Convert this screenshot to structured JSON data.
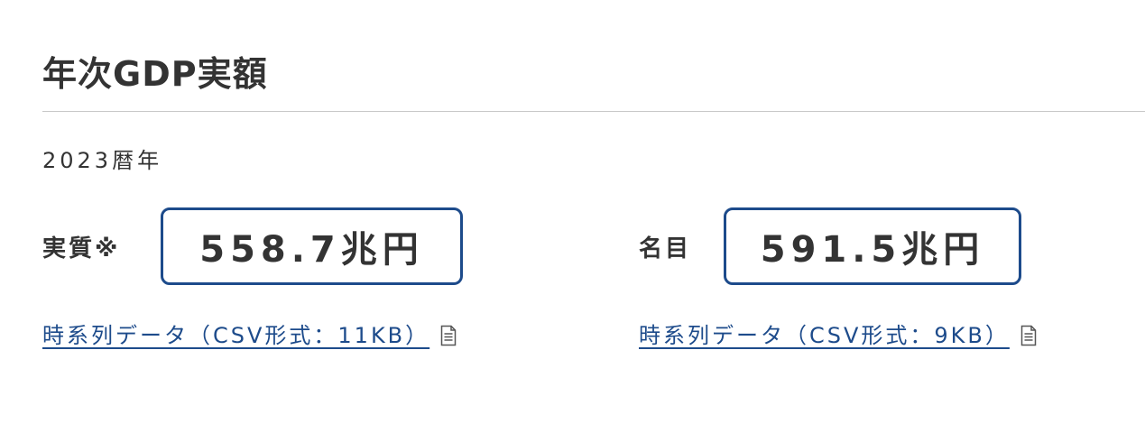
{
  "page": {
    "title": "年次GDP実額",
    "year": "2023暦年"
  },
  "real": {
    "label": "実質※",
    "value": "558.7兆円",
    "link_text": "時系列データ（CSV形式：11KB）",
    "link_icon": "document-icon"
  },
  "nominal": {
    "label": "名目",
    "value": "591.5兆円",
    "link_text": "時系列データ（CSV形式：9KB）",
    "link_icon": "document-icon"
  },
  "colors": {
    "accent": "#1d4b8b",
    "text": "#333333",
    "rule": "#c8c8c8"
  }
}
